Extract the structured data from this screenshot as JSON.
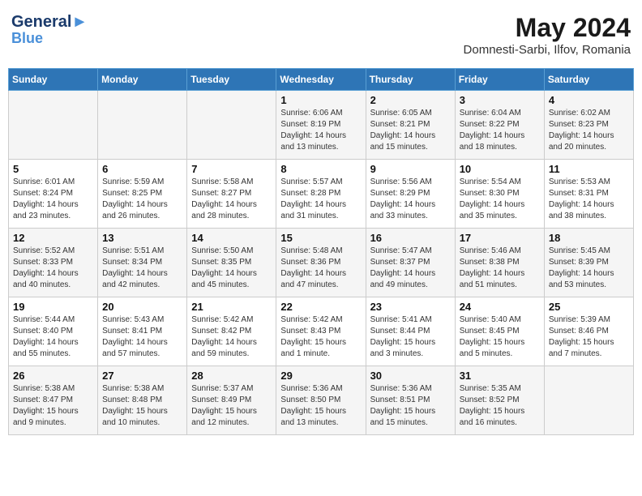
{
  "header": {
    "logo_line1": "General",
    "logo_line2": "Blue",
    "month": "May 2024",
    "location": "Domnesti-Sarbi, Ilfov, Romania"
  },
  "weekdays": [
    "Sunday",
    "Monday",
    "Tuesday",
    "Wednesday",
    "Thursday",
    "Friday",
    "Saturday"
  ],
  "weeks": [
    [
      {
        "day": "",
        "info": ""
      },
      {
        "day": "",
        "info": ""
      },
      {
        "day": "",
        "info": ""
      },
      {
        "day": "1",
        "info": "Sunrise: 6:06 AM\nSunset: 8:19 PM\nDaylight: 14 hours\nand 13 minutes."
      },
      {
        "day": "2",
        "info": "Sunrise: 6:05 AM\nSunset: 8:21 PM\nDaylight: 14 hours\nand 15 minutes."
      },
      {
        "day": "3",
        "info": "Sunrise: 6:04 AM\nSunset: 8:22 PM\nDaylight: 14 hours\nand 18 minutes."
      },
      {
        "day": "4",
        "info": "Sunrise: 6:02 AM\nSunset: 8:23 PM\nDaylight: 14 hours\nand 20 minutes."
      }
    ],
    [
      {
        "day": "5",
        "info": "Sunrise: 6:01 AM\nSunset: 8:24 PM\nDaylight: 14 hours\nand 23 minutes."
      },
      {
        "day": "6",
        "info": "Sunrise: 5:59 AM\nSunset: 8:25 PM\nDaylight: 14 hours\nand 26 minutes."
      },
      {
        "day": "7",
        "info": "Sunrise: 5:58 AM\nSunset: 8:27 PM\nDaylight: 14 hours\nand 28 minutes."
      },
      {
        "day": "8",
        "info": "Sunrise: 5:57 AM\nSunset: 8:28 PM\nDaylight: 14 hours\nand 31 minutes."
      },
      {
        "day": "9",
        "info": "Sunrise: 5:56 AM\nSunset: 8:29 PM\nDaylight: 14 hours\nand 33 minutes."
      },
      {
        "day": "10",
        "info": "Sunrise: 5:54 AM\nSunset: 8:30 PM\nDaylight: 14 hours\nand 35 minutes."
      },
      {
        "day": "11",
        "info": "Sunrise: 5:53 AM\nSunset: 8:31 PM\nDaylight: 14 hours\nand 38 minutes."
      }
    ],
    [
      {
        "day": "12",
        "info": "Sunrise: 5:52 AM\nSunset: 8:33 PM\nDaylight: 14 hours\nand 40 minutes."
      },
      {
        "day": "13",
        "info": "Sunrise: 5:51 AM\nSunset: 8:34 PM\nDaylight: 14 hours\nand 42 minutes."
      },
      {
        "day": "14",
        "info": "Sunrise: 5:50 AM\nSunset: 8:35 PM\nDaylight: 14 hours\nand 45 minutes."
      },
      {
        "day": "15",
        "info": "Sunrise: 5:48 AM\nSunset: 8:36 PM\nDaylight: 14 hours\nand 47 minutes."
      },
      {
        "day": "16",
        "info": "Sunrise: 5:47 AM\nSunset: 8:37 PM\nDaylight: 14 hours\nand 49 minutes."
      },
      {
        "day": "17",
        "info": "Sunrise: 5:46 AM\nSunset: 8:38 PM\nDaylight: 14 hours\nand 51 minutes."
      },
      {
        "day": "18",
        "info": "Sunrise: 5:45 AM\nSunset: 8:39 PM\nDaylight: 14 hours\nand 53 minutes."
      }
    ],
    [
      {
        "day": "19",
        "info": "Sunrise: 5:44 AM\nSunset: 8:40 PM\nDaylight: 14 hours\nand 55 minutes."
      },
      {
        "day": "20",
        "info": "Sunrise: 5:43 AM\nSunset: 8:41 PM\nDaylight: 14 hours\nand 57 minutes."
      },
      {
        "day": "21",
        "info": "Sunrise: 5:42 AM\nSunset: 8:42 PM\nDaylight: 14 hours\nand 59 minutes."
      },
      {
        "day": "22",
        "info": "Sunrise: 5:42 AM\nSunset: 8:43 PM\nDaylight: 15 hours\nand 1 minute."
      },
      {
        "day": "23",
        "info": "Sunrise: 5:41 AM\nSunset: 8:44 PM\nDaylight: 15 hours\nand 3 minutes."
      },
      {
        "day": "24",
        "info": "Sunrise: 5:40 AM\nSunset: 8:45 PM\nDaylight: 15 hours\nand 5 minutes."
      },
      {
        "day": "25",
        "info": "Sunrise: 5:39 AM\nSunset: 8:46 PM\nDaylight: 15 hours\nand 7 minutes."
      }
    ],
    [
      {
        "day": "26",
        "info": "Sunrise: 5:38 AM\nSunset: 8:47 PM\nDaylight: 15 hours\nand 9 minutes."
      },
      {
        "day": "27",
        "info": "Sunrise: 5:38 AM\nSunset: 8:48 PM\nDaylight: 15 hours\nand 10 minutes."
      },
      {
        "day": "28",
        "info": "Sunrise: 5:37 AM\nSunset: 8:49 PM\nDaylight: 15 hours\nand 12 minutes."
      },
      {
        "day": "29",
        "info": "Sunrise: 5:36 AM\nSunset: 8:50 PM\nDaylight: 15 hours\nand 13 minutes."
      },
      {
        "day": "30",
        "info": "Sunrise: 5:36 AM\nSunset: 8:51 PM\nDaylight: 15 hours\nand 15 minutes."
      },
      {
        "day": "31",
        "info": "Sunrise: 5:35 AM\nSunset: 8:52 PM\nDaylight: 15 hours\nand 16 minutes."
      },
      {
        "day": "",
        "info": ""
      }
    ]
  ]
}
